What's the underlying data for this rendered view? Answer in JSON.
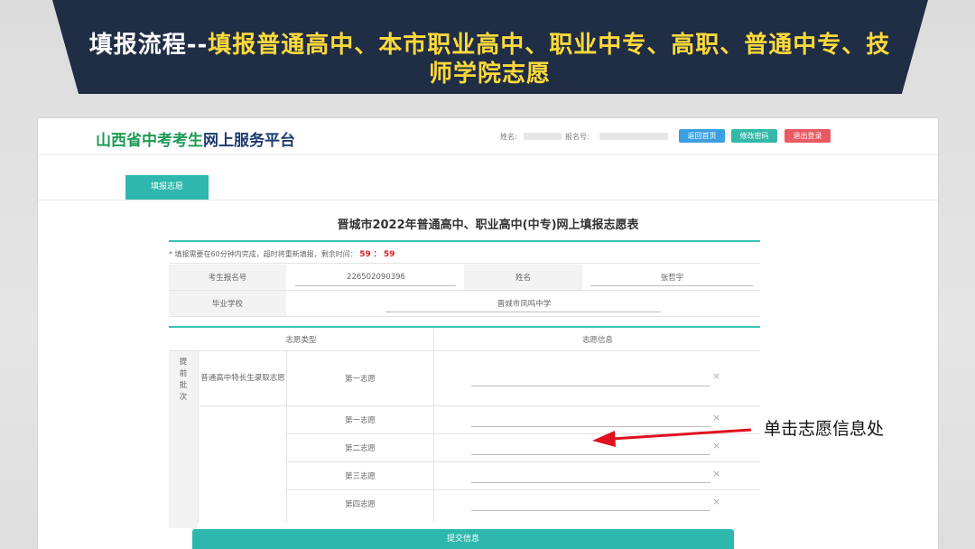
{
  "slide": {
    "title_prefix": "填报流程--",
    "title_rest": "填报普通高中、本市职业高中、职业中专、高职、普通中专、技师学院志愿"
  },
  "header": {
    "logo_green": "山西省中考考生",
    "logo_navy": "网上服务平台",
    "name_label": "姓名:",
    "reg_label": "报名号:",
    "buttons": {
      "home": "返回首页",
      "change_password": "修改密码",
      "logout": "退出登录"
    },
    "colors": {
      "home": "#3b9fe0",
      "change_password": "#34b8a8",
      "logout": "#e85a5f"
    }
  },
  "tabs": {
    "active": "填报志愿"
  },
  "form": {
    "title": "晋城市2022年普通高中、职业高中(中专)网上填报志愿表",
    "notice_text": "* 填报需要在60分钟内完成，超时将重新填报，剩余时间：",
    "timer_min": "59",
    "timer_sep": "：",
    "timer_sec": "59",
    "info": {
      "reg_no_label": "考生报名号",
      "reg_no_value": "226502090396",
      "name_label": "姓名",
      "name_value": "张哲宇",
      "school_label": "毕业学校",
      "school_value": "晋城市凤鸣中学"
    },
    "table": {
      "col_type": "志愿类型",
      "col_info": "志愿信息",
      "early_batch": "提\n前\n批\n次",
      "special_category": "普通高中特长生录取志愿",
      "rows": [
        "第一志愿",
        "第一志愿",
        "第二志愿",
        "第三志愿",
        "第四志愿"
      ]
    },
    "submit": "提交信息"
  },
  "annotation": {
    "text": "单击志愿信息处"
  },
  "colors": {
    "teal": "#2eb8ad",
    "banner": "#1f2d45",
    "title_yellow": "#ffd93b",
    "arrow_red": "#e01020"
  }
}
